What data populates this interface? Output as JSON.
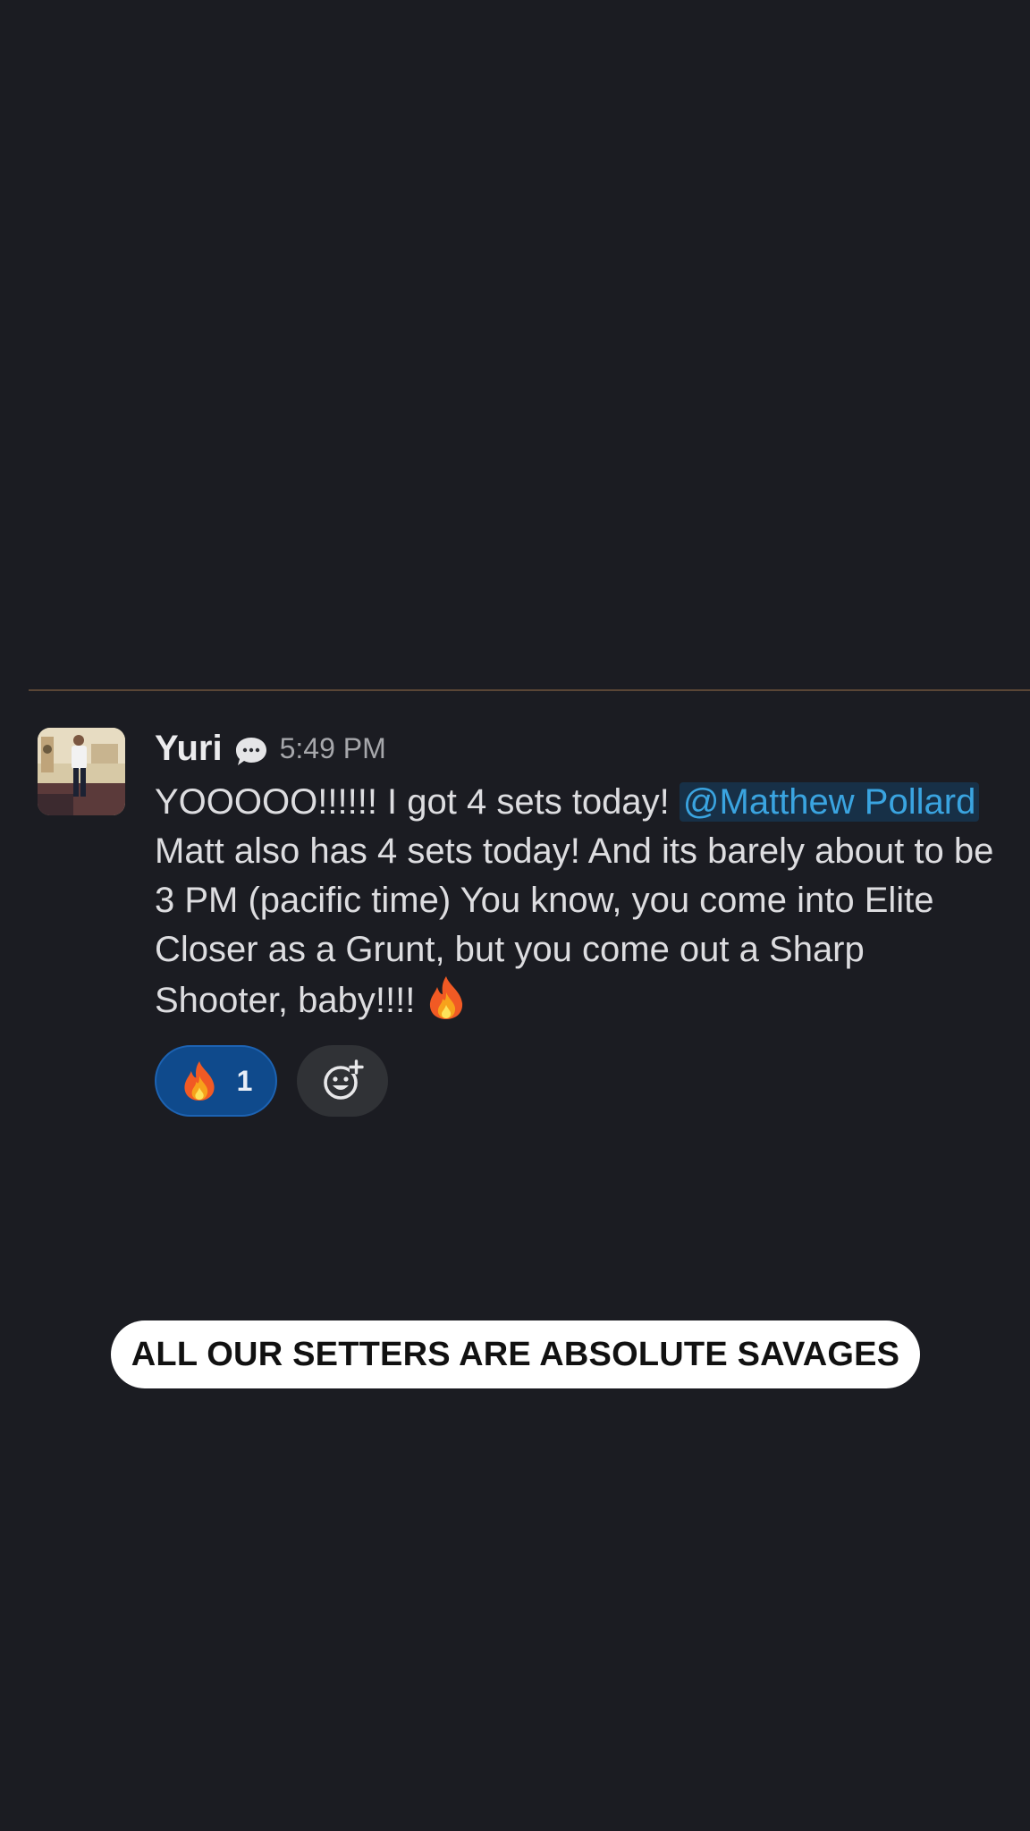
{
  "message": {
    "author": "Yuri",
    "timestamp": "5:49 PM",
    "text_before_mention": "YOOOOO!!!!!! I got 4 sets today! ",
    "mention": "@Matthew Pollard",
    "text_after_mention": " Matt also has 4 sets today!  And its barely about to be 3 PM (pacific time) You know, you come into Elite Closer as a Grunt, but you come out a Sharp Shooter, baby!!!! ",
    "trailing_emoji": "fire-icon",
    "status_icon": "speech-bubble-icon"
  },
  "reactions": [
    {
      "emoji": "fire-icon",
      "count": "1",
      "selected": true
    }
  ],
  "add_reaction_icon": "add-emoji-icon",
  "caption": "ALL OUR SETTERS ARE ABSOLUTE SAVAGES",
  "colors": {
    "background": "#1b1c22",
    "mention_text": "#3aa4e0",
    "mention_bg": "#173047",
    "reaction_bg": "#0f4a8c",
    "divider": "#5a4636"
  }
}
